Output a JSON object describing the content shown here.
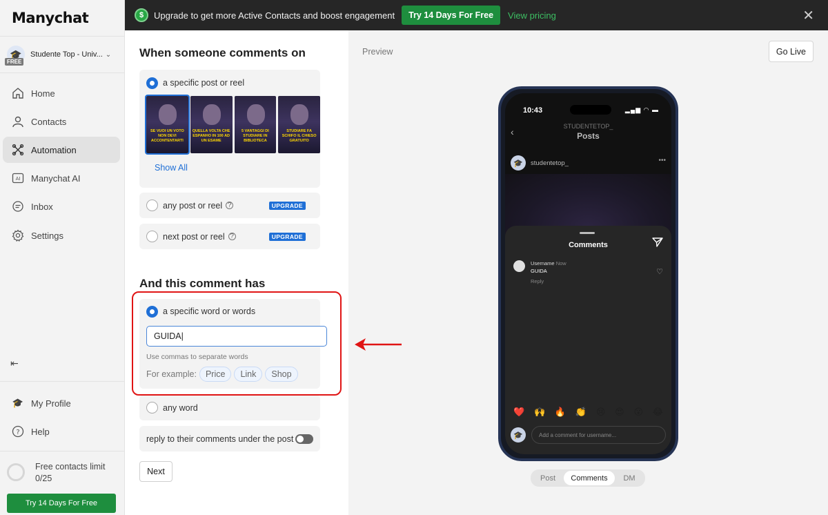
{
  "sidebar": {
    "logo": "Manychat",
    "account": {
      "name": "Studente Top - Univ...",
      "badge": "FREE"
    },
    "nav": [
      {
        "label": "Home",
        "icon": "home-icon"
      },
      {
        "label": "Contacts",
        "icon": "person-icon"
      },
      {
        "label": "Automation",
        "icon": "automation-icon"
      },
      {
        "label": "Manychat AI",
        "icon": "ai-icon"
      },
      {
        "label": "Inbox",
        "icon": "inbox-icon"
      },
      {
        "label": "Settings",
        "icon": "gear-icon"
      }
    ],
    "bottom": [
      {
        "label": "My Profile",
        "icon": "avatar-icon"
      },
      {
        "label": "Help",
        "icon": "help-icon"
      }
    ],
    "limit": {
      "title": "Free contacts limit",
      "count": "0/25"
    },
    "trial_button": "Try 14 Days For Free"
  },
  "banner": {
    "icon_glyph": "$",
    "text": "Upgrade to get more Active Contacts and boost engagement",
    "cta": "Try 14 Days For Free",
    "link": "View pricing"
  },
  "trigger": {
    "heading": "When someone comments on",
    "options": {
      "specific": "a specific post or reel",
      "any": "any post or reel",
      "next": "next post or reel"
    },
    "upgrade_label": "UPGRADE",
    "thumbs": [
      "SE VUOI UN VOTO NON DEVI ACCONTENTARTI",
      "QUELLA VOLTA CHE ESPANHO IN 100 AD UN ESAME",
      "5 VANTAGGI DI STUDIARE IN BIBLIOTECA",
      "STUDIARE FA SCHIFO IL CHIESO GRATUITO"
    ],
    "show_all": "Show All"
  },
  "keywords": {
    "heading": "And this comment has",
    "specific": "a specific word or words",
    "value": "GUIDA",
    "hint": "Use commas to separate words",
    "example_label": "For example:",
    "examples": [
      "Price",
      "Link",
      "Shop"
    ],
    "any": "any word",
    "reply": "reply to their comments under the post",
    "next": "Next"
  },
  "preview": {
    "label": "Preview",
    "go_live": "Go Live",
    "phone": {
      "time": "10:43",
      "account": "STUDENTETOP_",
      "posts": "Posts",
      "username": "studentetop_",
      "sheet_title": "Comments",
      "comment_user": "Username",
      "comment_time": "Now",
      "comment_text": "GUIDA",
      "reply": "Reply",
      "emojis": [
        "❤️",
        "🙌",
        "🔥",
        "👏",
        "😢",
        "😍",
        "😮",
        "😂"
      ],
      "add_placeholder": "Add a comment for username..."
    },
    "tabs": [
      "Post",
      "Comments",
      "DM"
    ]
  },
  "colors": {
    "accent": "#1f6fd6",
    "green": "#1e8e3e",
    "highlight": "#e01414"
  }
}
